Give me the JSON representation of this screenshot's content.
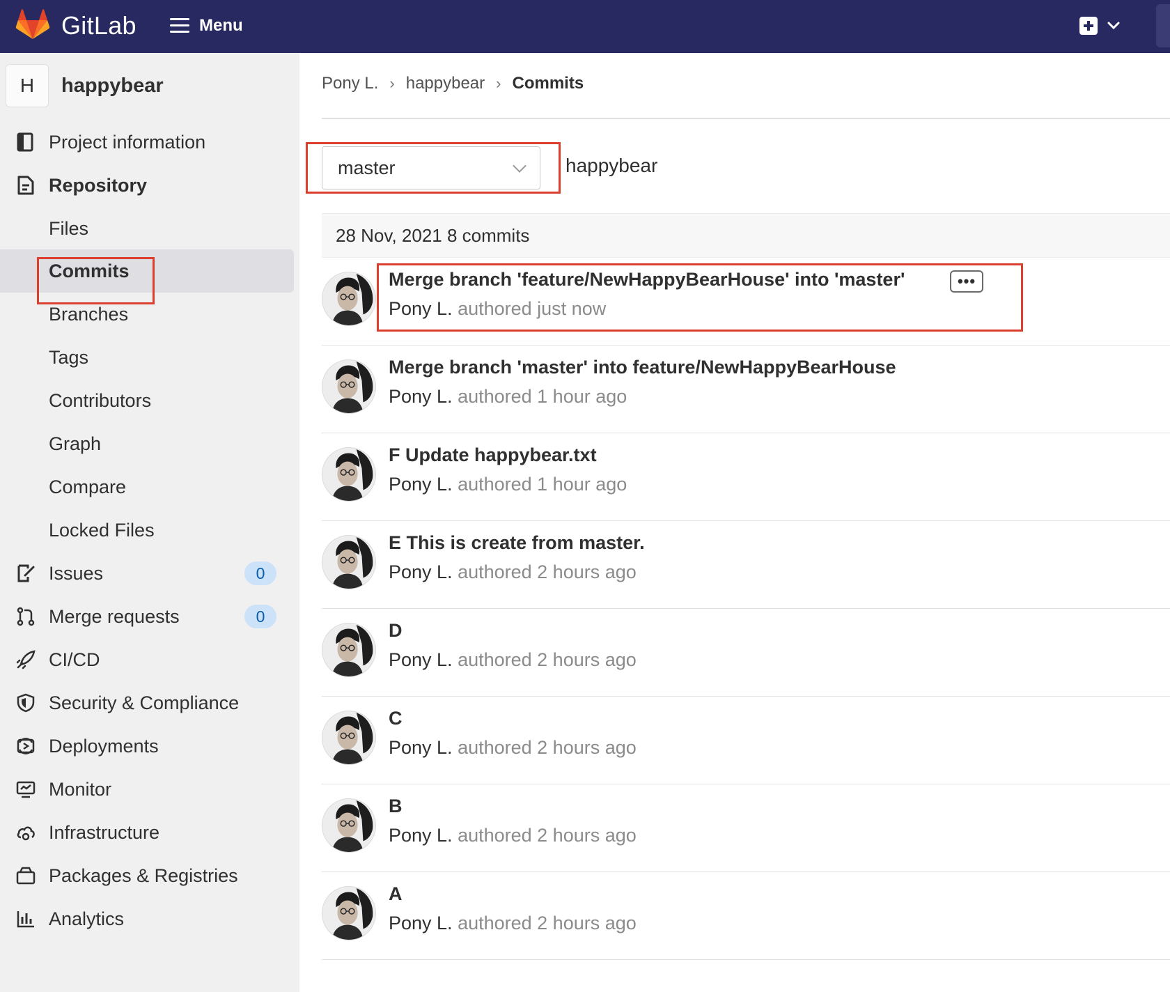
{
  "topbar": {
    "brand": "GitLab",
    "menu_label": "Menu",
    "colors": {
      "background": "#292961",
      "accent": "#e24329"
    }
  },
  "sidebar": {
    "project_initial": "H",
    "project_name": "happybear",
    "items": [
      {
        "label": "Project information",
        "icon": "book-icon"
      },
      {
        "label": "Repository",
        "icon": "document-icon"
      },
      {
        "label": "Files"
      },
      {
        "label": "Commits"
      },
      {
        "label": "Branches"
      },
      {
        "label": "Tags"
      },
      {
        "label": "Contributors"
      },
      {
        "label": "Graph"
      },
      {
        "label": "Compare"
      },
      {
        "label": "Locked Files"
      },
      {
        "label": "Issues",
        "icon": "issues-icon",
        "badge": "0"
      },
      {
        "label": "Merge requests",
        "icon": "merge-request-icon",
        "badge": "0"
      },
      {
        "label": "CI/CD",
        "icon": "rocket-icon"
      },
      {
        "label": "Security & Compliance",
        "icon": "shield-icon"
      },
      {
        "label": "Deployments",
        "icon": "deployments-icon"
      },
      {
        "label": "Monitor",
        "icon": "monitor-icon"
      },
      {
        "label": "Infrastructure",
        "icon": "cloud-gear-icon"
      },
      {
        "label": "Packages & Registries",
        "icon": "package-icon"
      },
      {
        "label": "Analytics",
        "icon": "chart-icon"
      }
    ]
  },
  "breadcrumb": {
    "items": [
      "Pony L.",
      "happybear",
      "Commits"
    ]
  },
  "filter": {
    "branch": "master",
    "path": "happybear"
  },
  "day_group": {
    "label": "28 Nov, 2021 8 commits"
  },
  "commits": [
    {
      "title": "Merge branch 'feature/NewHappyBearHouse' into 'master'",
      "author": "Pony L.",
      "meta": "authored just now",
      "has_description": true,
      "ellipsis": "•••"
    },
    {
      "title": "Merge branch 'master' into feature/NewHappyBearHouse",
      "author": "Pony L.",
      "meta": "authored 1 hour ago"
    },
    {
      "title": "F Update happybear.txt",
      "author": "Pony L.",
      "meta": "authored 1 hour ago"
    },
    {
      "title": "E This is create from master.",
      "author": "Pony L.",
      "meta": "authored 2 hours ago"
    },
    {
      "title": "D",
      "author": "Pony L.",
      "meta": "authored 2 hours ago"
    },
    {
      "title": "C",
      "author": "Pony L.",
      "meta": "authored 2 hours ago"
    },
    {
      "title": "B",
      "author": "Pony L.",
      "meta": "authored 2 hours ago"
    },
    {
      "title": "A",
      "author": "Pony L.",
      "meta": "authored 2 hours ago"
    }
  ],
  "annotations": {
    "highlight_color": "#dd3f2e"
  }
}
